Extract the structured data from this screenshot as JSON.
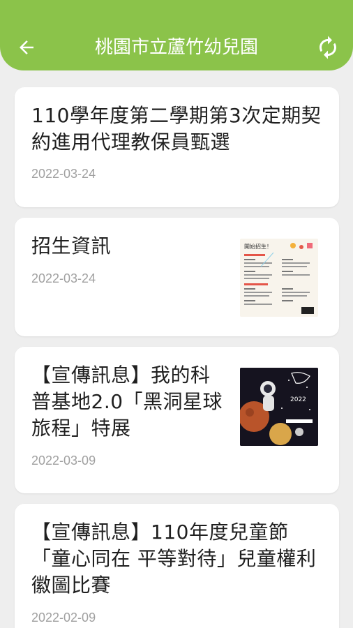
{
  "header": {
    "title": "桃園市立蘆竹幼兒園",
    "back_icon": "arrow-left-icon",
    "refresh_icon": "refresh-icon",
    "bar_color": "#8bc34a"
  },
  "posts": [
    {
      "title": "110學年度第二學期第3次定期契約進用代理教保員甄選",
      "date": "2022-03-24"
    },
    {
      "title": "招生資訊",
      "date": "2022-03-24",
      "thumbnail": "admission-flyer-image",
      "thumbnail_heading": "開始招生！"
    },
    {
      "title": "【宣傳訊息】我的科普基地2.0「黑洞星球旅程」特展",
      "date": "2022-03-09",
      "thumbnail": "astronaut-space-poster-image",
      "thumbnail_text": "2022"
    },
    {
      "title": "【宣傳訊息】110年度兒童節「童心同在 平等對待」兒童權利徽圖比賽",
      "date": "2022-02-09"
    }
  ]
}
